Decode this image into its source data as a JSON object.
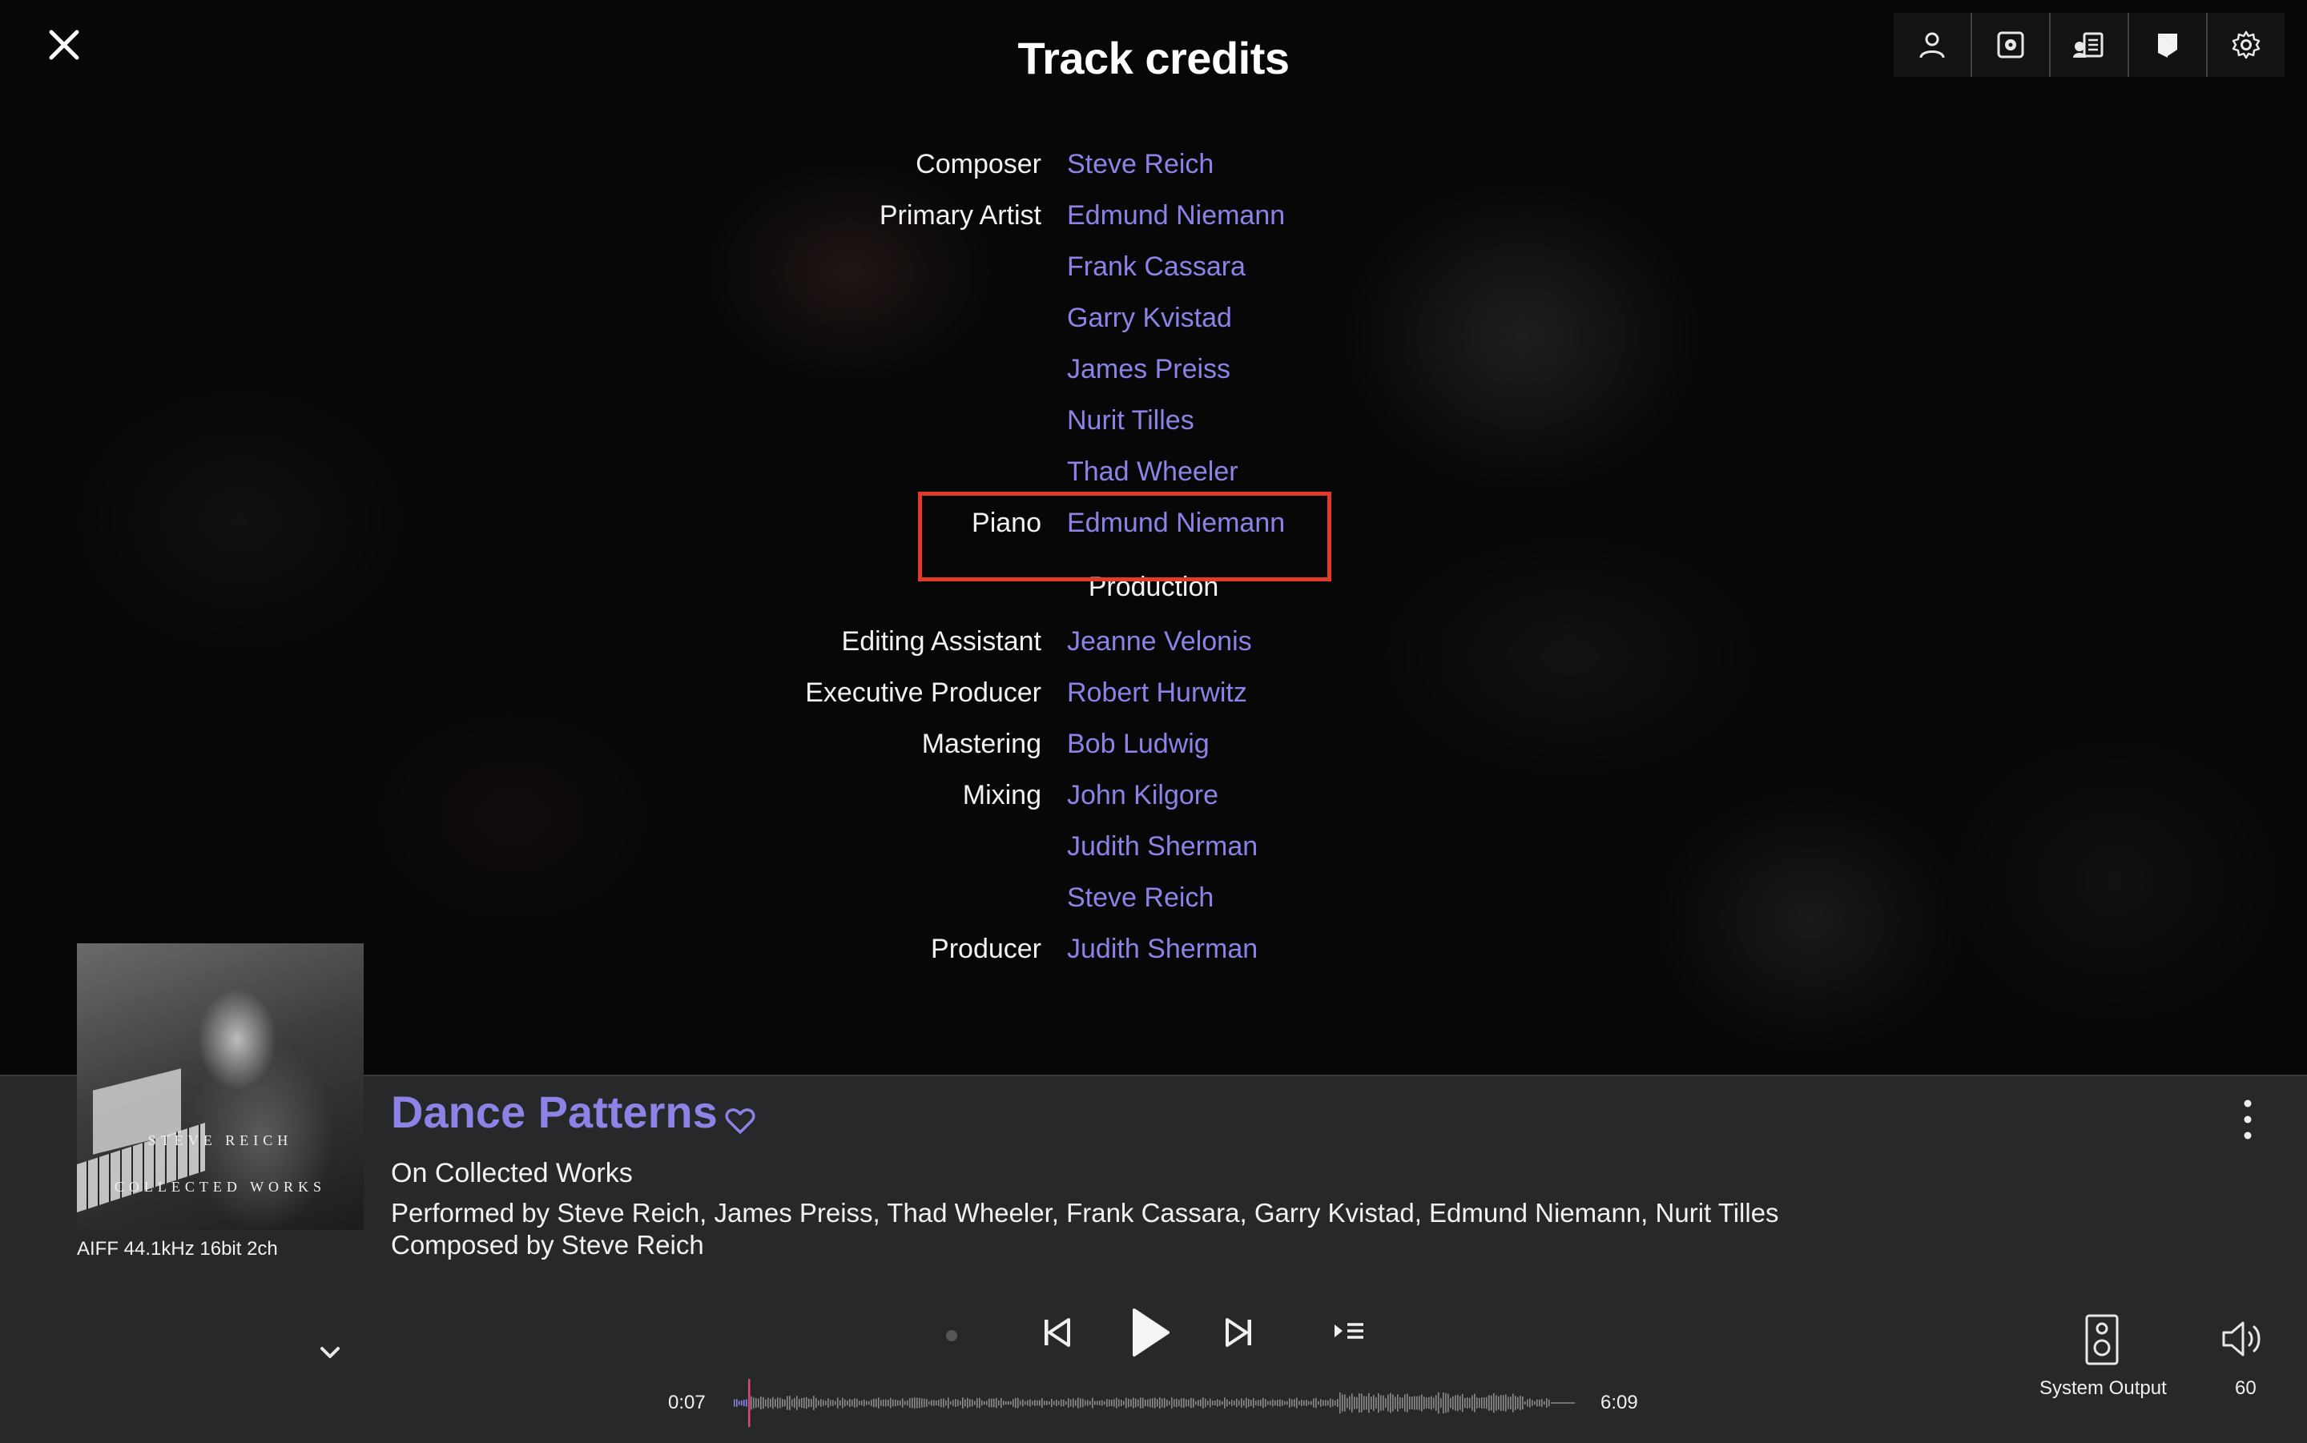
{
  "header": {
    "title": "Track credits"
  },
  "credits": [
    {
      "role": "Composer",
      "name": "Steve Reich"
    },
    {
      "role": "Primary Artist",
      "name": "Edmund Niemann"
    },
    {
      "role": "",
      "name": "Frank Cassara"
    },
    {
      "role": "",
      "name": "Garry Kvistad"
    },
    {
      "role": "",
      "name": "James Preiss"
    },
    {
      "role": "",
      "name": "Nurit Tilles"
    },
    {
      "role": "",
      "name": "Thad Wheeler"
    },
    {
      "role": "Piano",
      "name": "Edmund Niemann"
    }
  ],
  "production": {
    "heading": "Production",
    "rows": [
      {
        "role": "Editing Assistant",
        "name": "Jeanne Velonis"
      },
      {
        "role": "Executive Producer",
        "name": "Robert Hurwitz"
      },
      {
        "role": "Mastering",
        "name": "Bob Ludwig"
      },
      {
        "role": "Mixing",
        "name": "John Kilgore"
      },
      {
        "role": "",
        "name": "Judith Sherman"
      },
      {
        "role": "",
        "name": "Steve Reich"
      },
      {
        "role": "Producer",
        "name": "Judith Sherman"
      }
    ]
  },
  "player": {
    "cover_line1": "STEVE REICH",
    "cover_line2": "COLLECTED WORKS",
    "format": "AIFF 44.1kHz 16bit 2ch",
    "track_title": "Dance Patterns",
    "album_prefix": "On ",
    "album": "Collected Works",
    "performed": "Performed by Steve Reich, James Preiss, Thad Wheeler, Frank Cassara, Garry Kvistad, Edmund Niemann, Nurit Tilles",
    "composed": "Composed by Steve Reich",
    "time_current": "0:07",
    "time_total": "6:09",
    "progress": 0.019,
    "output_label": "System Output",
    "volume": "60"
  },
  "colors": {
    "accent": "#8b84e6",
    "highlight_box": "#e23b2a",
    "player_bg": "#27282a",
    "playhead": "#e0457a"
  },
  "icons": [
    "close-icon",
    "artist-icon",
    "album-icon",
    "queue-icon",
    "credits-icon",
    "settings-icon",
    "heart-icon",
    "more-vertical-icon",
    "chevron-down-icon",
    "dot-icon",
    "previous-icon",
    "play-icon",
    "next-icon",
    "add-to-queue-icon",
    "speaker-icon",
    "volume-icon"
  ]
}
